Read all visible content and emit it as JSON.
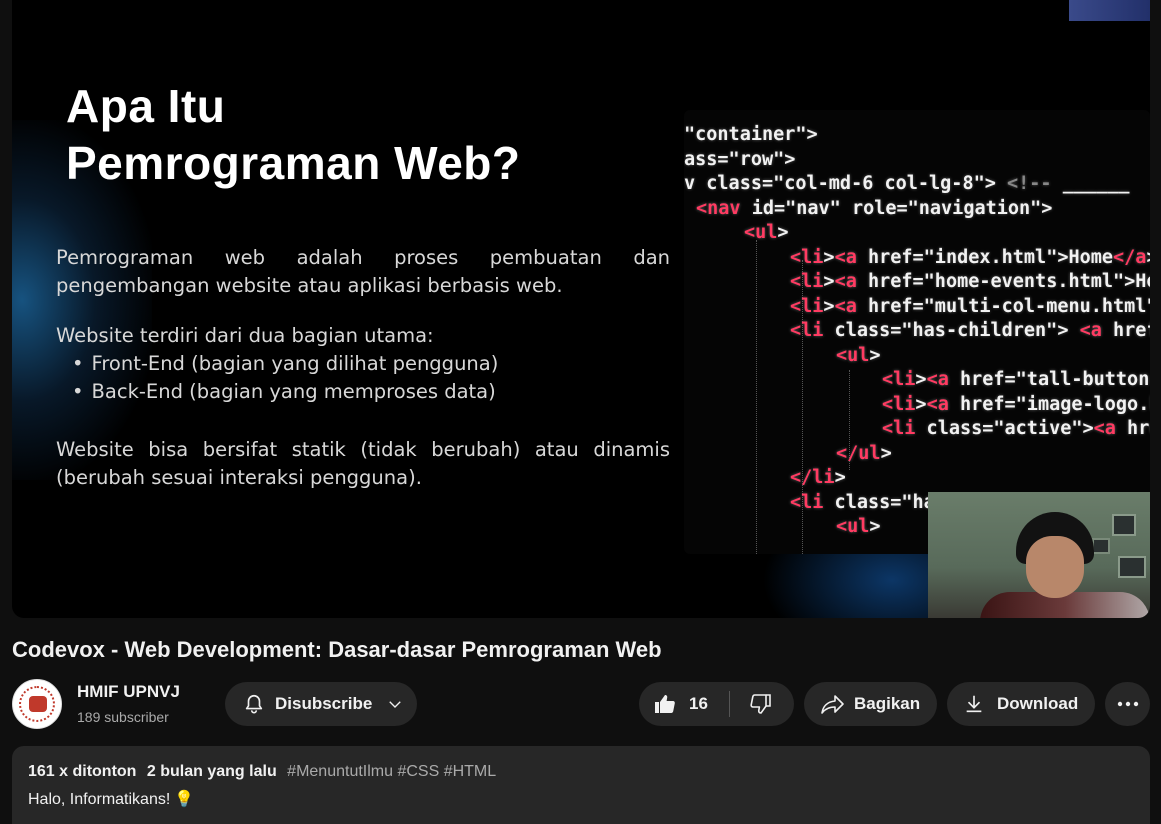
{
  "video": {
    "slide": {
      "title_line1": "Apa Itu",
      "title_line2": "Pemrograman Web?",
      "para1": "Pemrograman web adalah proses pembuatan dan pengembangan website atau aplikasi berbasis web.",
      "para2": "Website terdiri dari dua bagian utama:",
      "bullets": [
        "Front-End (bagian yang dilihat pengguna)",
        "Back-End (bagian yang memproses data)"
      ],
      "para3": "Website bisa bersifat statik (tidak berubah) atau dinamis (berubah sesuai interaksi pengguna)."
    },
    "code_lines": [
      "\"container\">",
      "ass=\"row\">",
      "v class=\"col-md-6 col-lg-8\"> <!-- ______",
      "<nav id=\"nav\" role=\"navigation\">",
      "<ul>",
      "<li><a href=\"index.html\">Home</a><",
      "<li><a href=\"home-events.html\">Hom",
      "<li><a href=\"multi-col-menu.html\">",
      "<li class=\"has-children\"> <a href=",
      "<ul>",
      "<li><a href=\"tall-button-he",
      "<li><a href=\"image-logo.htm",
      "<li class=\"active\"><a href=",
      "</ul>",
      "</li>",
      "<li class=\"ha",
      "<ul>"
    ]
  },
  "title": "Codevox - Web Development: Dasar-dasar Pemrograman Web",
  "channel": {
    "name": "HMIF UPNVJ",
    "subscribers": "189 subscriber"
  },
  "actions": {
    "subscribe_label": "Disubscribe",
    "like_count": "16",
    "share_label": "Bagikan",
    "download_label": "Download"
  },
  "description": {
    "views": "161 x ditonton",
    "date": "2 bulan yang lalu",
    "tags": "#MenuntutIlmu #CSS #HTML",
    "text": "Halo, Informatikans!"
  },
  "icons": {
    "like": "thumbs-up-icon",
    "dislike": "thumbs-down-icon",
    "share": "share-arrow-icon",
    "download": "download-icon",
    "subscribe": "bell-icon",
    "more": "more-horizontal-icon"
  },
  "colors": {
    "background": "#0f0f0f",
    "surface": "#272727",
    "code_tag": "#ff3b62"
  }
}
